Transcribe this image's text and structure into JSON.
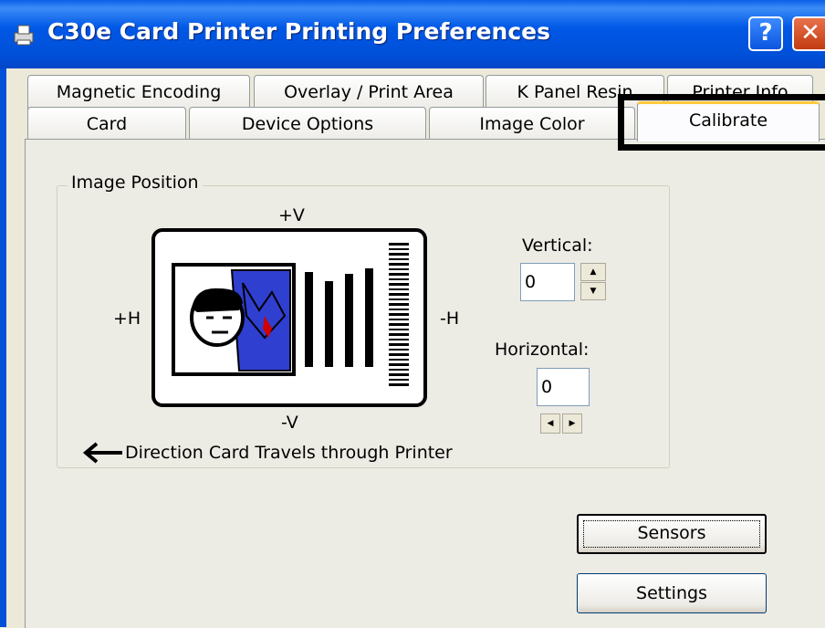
{
  "window": {
    "title": "C30e Card Printer Printing Preferences",
    "help_label": "?",
    "close_label": "✕"
  },
  "tabs_back": [
    "Magnetic Encoding",
    "Overlay / Print Area",
    "K Panel Resin",
    "Printer Info"
  ],
  "tabs_front": [
    "Card",
    "Device Options",
    "Image Color",
    "Calibrate"
  ],
  "active_tab": "Calibrate",
  "image_position": {
    "group_label": "Image Position",
    "plus_v": "+V",
    "minus_v": "-V",
    "plus_h": "+H",
    "minus_h": "-H",
    "direction_text": "Direction Card Travels through Printer",
    "vertical_label": "Vertical:",
    "vertical_value": "0",
    "horizontal_label": "Horizontal:",
    "horizontal_value": "0"
  },
  "buttons": {
    "sensors": "Sensors",
    "settings": "Settings"
  },
  "colors": {
    "title_bar": "#0054e3",
    "active_tab_accent": "#ffc83c",
    "card_photo_suit": "#2f3fd0"
  }
}
